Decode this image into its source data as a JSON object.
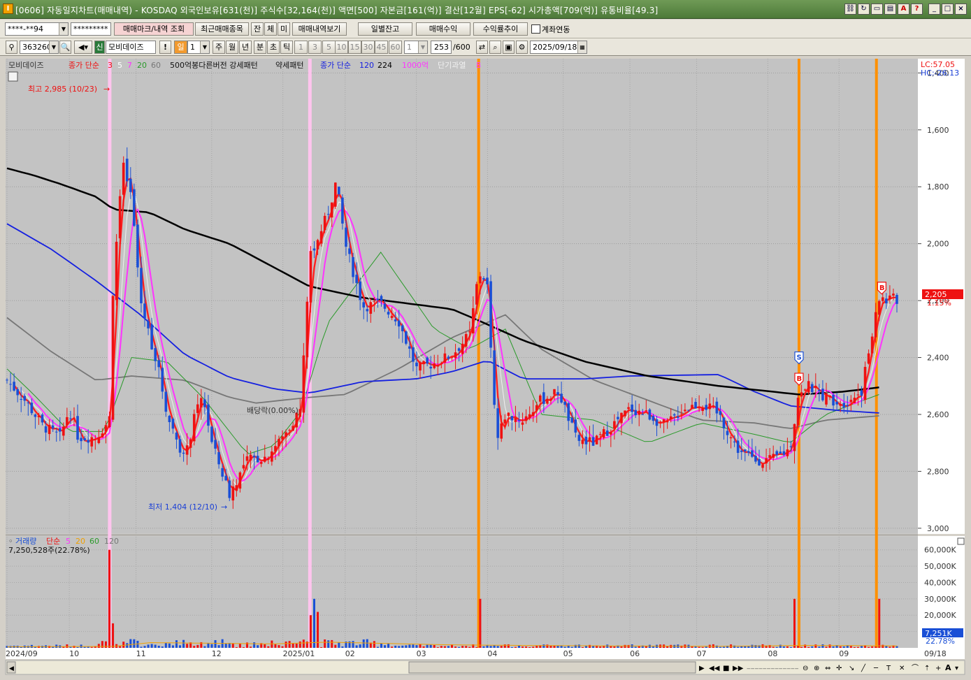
{
  "window": {
    "title": "[0606] 자동일지차트(매매내역) - KOSDAQ 외국인보유[631(천)] 주식수[32,164(천)] 액면[500] 자본금[161(억)] 결산[12월] EPS[-62] 시가총액[709(억)] 유통비율[49.3]",
    "app_icon": "I",
    "buttons": [
      "link-icon",
      "refresh-icon",
      "screen-icon",
      "window-icon",
      "font-icon",
      "help-icon",
      "minimize-icon",
      "maximize-icon",
      "close-icon"
    ]
  },
  "toolbar1": {
    "account": "****-**94",
    "password": "*********",
    "trade_mark_btn": "매매마크/내역 조회",
    "recent_btn": "최근매매종목",
    "tabs": [
      "잔",
      "체",
      "미"
    ],
    "trade_view_btn": "매매내역보기",
    "daily_balance_btn": "일별잔고",
    "trade_profit_btn": "매매수익",
    "return_trend_btn": "수익률추이",
    "account_link_label": "계좌연동"
  },
  "toolbar2": {
    "code": "363260",
    "new_badge": "신",
    "stock_name": "모비데이즈",
    "period_sel": "일",
    "period_num": "1",
    "periods": [
      "주",
      "월",
      "년",
      "분",
      "초",
      "틱"
    ],
    "intervals": [
      "1",
      "3",
      "5",
      "10",
      "15",
      "30",
      "45",
      "60"
    ],
    "interval_sel": "1",
    "count": "253",
    "count_max": "/600",
    "date": "2025/09/18"
  },
  "legend": {
    "stock": "모비데이즈",
    "close_ma_label": "종가 단순",
    "close_ma": [
      "3",
      "5",
      "7",
      "20",
      "60"
    ],
    "custom1": "500억봉다른버전 강세패턴",
    "custom2": "약세패턴",
    "close_ma2_label": "종가 단순",
    "close_ma2": [
      "120",
      "224"
    ],
    "amount": "1000억",
    "overheat": "단기과열",
    "overheat_n": "8"
  },
  "price_axis": {
    "ticks": [
      "3,000",
      "2,800",
      "2,600",
      "2,400",
      "2,200",
      "2,000",
      "1,800",
      "1,600",
      "1,400"
    ],
    "lc": "LC:57.05",
    "hc": "HC:-26.13",
    "current": "2,205",
    "current_pct": "1.15%"
  },
  "annotations": {
    "high": "최고 2,985 (10/23)",
    "low": "최저 1,404 (12/10)",
    "dividend": "배당락(0.00%)",
    "sell_mark": "S",
    "buy_mark": "B"
  },
  "volume_legend": {
    "label": "거래량",
    "ma_label": "단순",
    "ma": [
      "5",
      "20",
      "60",
      "120"
    ],
    "value": "7,250,528주(22.78%)"
  },
  "volume_axis": {
    "ticks": [
      "60,000K",
      "50,000K",
      "40,000K",
      "30,000K",
      "20,000K",
      "10,000K"
    ],
    "current": "7,251K",
    "current_pct": "22.78%"
  },
  "date_axis": [
    "2024/09",
    "10",
    "11",
    "12",
    "2025/01",
    "02",
    "03",
    "04",
    "05",
    "06",
    "07",
    "08",
    "09",
    "09/18"
  ],
  "colors": {
    "up": "#ee1111",
    "down": "#1a4fd6",
    "ma3": "#ff2020",
    "ma5": "#f0f0f0",
    "ma7": "#ff33ff",
    "ma20": "#2a9a2a",
    "ma60": "#777777",
    "ma120": "#1520e0",
    "ma224": "#000000",
    "chart_bg": "#c3c3c3",
    "highlight_pink": "#ffc4ee",
    "highlight_orange": "#ff9000"
  },
  "chart_data": {
    "type": "candlestick",
    "title": "모비데이즈",
    "x_range": [
      "2024/09",
      "09/18"
    ],
    "ylim": [
      1380,
      3050
    ],
    "y_ticks": [
      1400,
      1600,
      1800,
      2000,
      2200,
      2400,
      2600,
      2800,
      3000
    ],
    "high": {
      "value": 2985,
      "date": "10/23"
    },
    "low": {
      "value": 1404,
      "date": "12/10"
    },
    "last_close": 2205,
    "change_pct": 1.15,
    "volume_last": 7250528,
    "volume_ylim_k": [
      0,
      65000
    ],
    "highlight_days_pink": [
      0.115,
      0.34
    ],
    "highlight_days_orange": [
      0.53,
      0.89,
      0.977
    ],
    "trade_marks": [
      {
        "type": "S",
        "x": 0.89,
        "price": 2000
      },
      {
        "type": "B",
        "x": 0.89,
        "price": 1925
      },
      {
        "type": "B",
        "x": 0.983,
        "price": 2245
      }
    ],
    "ma224": [
      [
        0.0,
        2665
      ],
      [
        0.03,
        2640
      ],
      [
        0.06,
        2610
      ],
      [
        0.1,
        2565
      ],
      [
        0.12,
        2520
      ],
      [
        0.16,
        2510
      ],
      [
        0.2,
        2450
      ],
      [
        0.25,
        2400
      ],
      [
        0.34,
        2250
      ],
      [
        0.4,
        2210
      ],
      [
        0.5,
        2170
      ],
      [
        0.53,
        2130
      ],
      [
        0.58,
        2060
      ],
      [
        0.65,
        1985
      ],
      [
        0.72,
        1935
      ],
      [
        0.8,
        1900
      ],
      [
        0.86,
        1880
      ],
      [
        0.89,
        1870
      ],
      [
        0.94,
        1880
      ],
      [
        0.98,
        1895
      ]
    ],
    "ma120": [
      [
        0.0,
        2470
      ],
      [
        0.05,
        2380
      ],
      [
        0.1,
        2270
      ],
      [
        0.15,
        2150
      ],
      [
        0.2,
        2010
      ],
      [
        0.25,
        1930
      ],
      [
        0.3,
        1890
      ],
      [
        0.34,
        1875
      ],
      [
        0.4,
        1915
      ],
      [
        0.46,
        1925
      ],
      [
        0.5,
        1950
      ],
      [
        0.54,
        1990
      ],
      [
        0.58,
        1925
      ],
      [
        0.65,
        1925
      ],
      [
        0.7,
        1935
      ],
      [
        0.8,
        1940
      ],
      [
        0.84,
        1880
      ],
      [
        0.88,
        1830
      ],
      [
        0.93,
        1815
      ],
      [
        0.98,
        1805
      ]
    ],
    "ma60": [
      [
        0.0,
        2140
      ],
      [
        0.05,
        2020
      ],
      [
        0.1,
        1920
      ],
      [
        0.14,
        1935
      ],
      [
        0.2,
        1920
      ],
      [
        0.25,
        1860
      ],
      [
        0.28,
        1840
      ],
      [
        0.34,
        1860
      ],
      [
        0.38,
        1870
      ],
      [
        0.44,
        1960
      ],
      [
        0.5,
        2070
      ],
      [
        0.56,
        2150
      ],
      [
        0.6,
        2030
      ],
      [
        0.66,
        1920
      ],
      [
        0.72,
        1850
      ],
      [
        0.78,
        1780
      ],
      [
        0.84,
        1770
      ],
      [
        0.88,
        1750
      ],
      [
        0.92,
        1780
      ],
      [
        0.98,
        1795
      ]
    ],
    "ma20": [
      [
        0.0,
        1960
      ],
      [
        0.03,
        1870
      ],
      [
        0.07,
        1740
      ],
      [
        0.11,
        1740
      ],
      [
        0.14,
        2000
      ],
      [
        0.18,
        1985
      ],
      [
        0.22,
        1860
      ],
      [
        0.27,
        1660
      ],
      [
        0.3,
        1690
      ],
      [
        0.33,
        1810
      ],
      [
        0.36,
        2120
      ],
      [
        0.42,
        2370
      ],
      [
        0.48,
        2100
      ],
      [
        0.52,
        2030
      ],
      [
        0.56,
        2100
      ],
      [
        0.6,
        1800
      ],
      [
        0.66,
        1780
      ],
      [
        0.72,
        1700
      ],
      [
        0.78,
        1770
      ],
      [
        0.84,
        1730
      ],
      [
        0.88,
        1700
      ],
      [
        0.92,
        1800
      ],
      [
        0.98,
        1870
      ]
    ],
    "close_series": [
      [
        0.0,
        1920
      ],
      [
        0.02,
        1850
      ],
      [
        0.04,
        1760
      ],
      [
        0.06,
        1720
      ],
      [
        0.07,
        1820
      ],
      [
        0.08,
        1720
      ],
      [
        0.1,
        1720
      ],
      [
        0.115,
        1780
      ],
      [
        0.12,
        2300
      ],
      [
        0.13,
        2680
      ],
      [
        0.14,
        2560
      ],
      [
        0.15,
        2200
      ],
      [
        0.17,
        1960
      ],
      [
        0.18,
        1800
      ],
      [
        0.2,
        1640
      ],
      [
        0.21,
        1780
      ],
      [
        0.22,
        1870
      ],
      [
        0.23,
        1700
      ],
      [
        0.25,
        1520
      ],
      [
        0.27,
        1640
      ],
      [
        0.29,
        1650
      ],
      [
        0.31,
        1720
      ],
      [
        0.33,
        1820
      ],
      [
        0.34,
        2350
      ],
      [
        0.36,
        2500
      ],
      [
        0.37,
        2620
      ],
      [
        0.38,
        2400
      ],
      [
        0.4,
        2180
      ],
      [
        0.42,
        2190
      ],
      [
        0.44,
        2130
      ],
      [
        0.46,
        1960
      ],
      [
        0.48,
        1980
      ],
      [
        0.5,
        2010
      ],
      [
        0.52,
        2080
      ],
      [
        0.53,
        2300
      ],
      [
        0.54,
        2250
      ],
      [
        0.55,
        1700
      ],
      [
        0.56,
        1800
      ],
      [
        0.58,
        1780
      ],
      [
        0.6,
        1850
      ],
      [
        0.62,
        1880
      ],
      [
        0.64,
        1710
      ],
      [
        0.66,
        1700
      ],
      [
        0.68,
        1760
      ],
      [
        0.7,
        1820
      ],
      [
        0.72,
        1800
      ],
      [
        0.74,
        1760
      ],
      [
        0.76,
        1820
      ],
      [
        0.78,
        1840
      ],
      [
        0.8,
        1800
      ],
      [
        0.82,
        1680
      ],
      [
        0.84,
        1640
      ],
      [
        0.86,
        1640
      ],
      [
        0.88,
        1680
      ],
      [
        0.89,
        1880
      ],
      [
        0.9,
        1900
      ],
      [
        0.92,
        1860
      ],
      [
        0.94,
        1840
      ],
      [
        0.96,
        1880
      ],
      [
        0.98,
        2205
      ]
    ]
  }
}
